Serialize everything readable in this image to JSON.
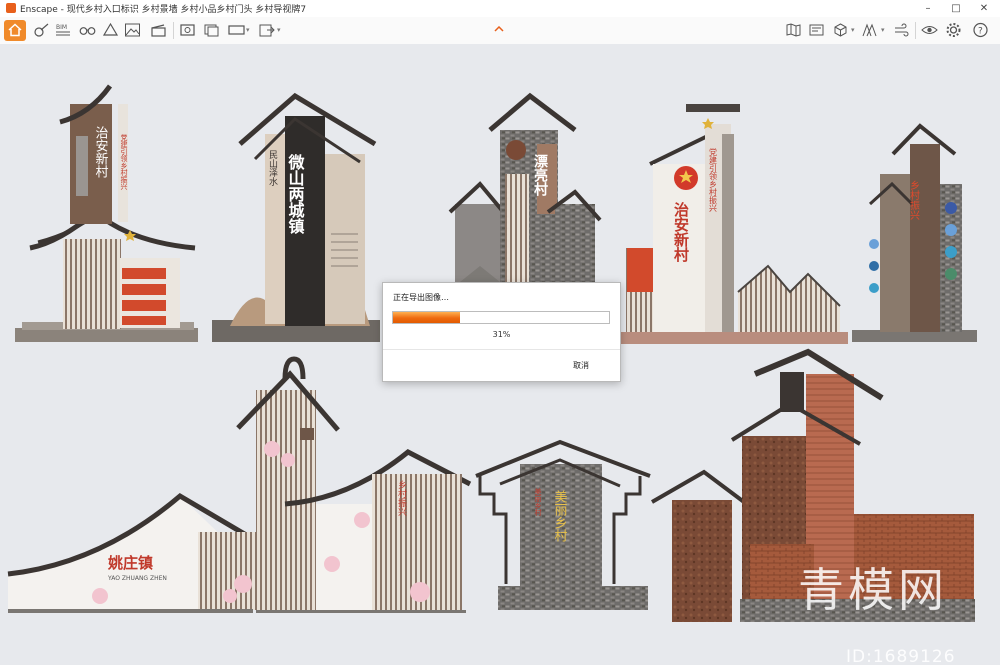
{
  "window": {
    "app_name": "Enscape",
    "title": "Enscape - 现代乡村入口标识 乡村景墙 乡村小品乡村门头 乡村导视牌7",
    "controls": [
      "–",
      "□",
      "✕"
    ]
  },
  "toolbar": {
    "active": "home-icon",
    "left_icons": [
      "home-icon",
      "brush-settings-icon",
      "bim-icon",
      "binoculars-icon",
      "object-icon",
      "mountain-icon",
      "paint-icon",
      "clapper-icon",
      "screenshot-icon",
      "batch-render-icon",
      "panorama-icon",
      "export-icon"
    ],
    "right_icons": [
      "map-icon",
      "asset-library-icon",
      "cube-icon",
      "views-icon",
      "wind-icon",
      "eye-icon",
      "gear-icon",
      "help-icon"
    ],
    "accent": "#f08a2a"
  },
  "scene": {
    "signs": [
      {
        "name": "sign-1",
        "text": "治安新村",
        "sub": "党建引领乡村振兴"
      },
      {
        "name": "sign-2",
        "text": "微山两城镇",
        "sub": "民山泽水"
      },
      {
        "name": "sign-3",
        "text": "漂亮村"
      },
      {
        "name": "sign-4",
        "text": "治安新村",
        "sub": "党建引领乡村振兴"
      },
      {
        "name": "sign-5",
        "text": "乡村振兴"
      },
      {
        "name": "sign-6",
        "text": "姚庄镇",
        "sub": "YAO ZHUANG ZHEN"
      },
      {
        "name": "sign-7",
        "text": "美丽乡村"
      },
      {
        "name": "sign-8",
        "text": ""
      }
    ]
  },
  "dialog": {
    "title": "正在导出图像…",
    "progress": 0.31,
    "percent_label": "31%",
    "cancel_label": "取消"
  },
  "watermark": {
    "text": "青模网",
    "id": "ID:1689126"
  }
}
